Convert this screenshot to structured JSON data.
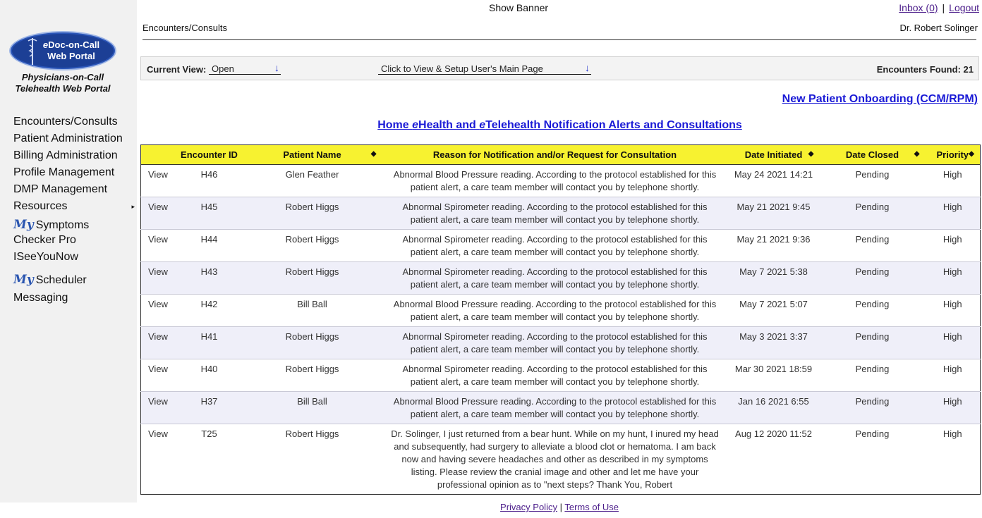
{
  "header": {
    "banner": "Show Banner",
    "inbox": "Inbox (0)",
    "separator": "|",
    "logout": "Logout",
    "breadcrumb": "Encounters/Consults",
    "user": "Dr. Robert Solinger"
  },
  "logo": {
    "prefix": "e",
    "line1_rest": "Doc-on-Call",
    "line2": "Web Portal",
    "sub1": "Physicians-on-Call",
    "sub2": "Telehealth Web Portal"
  },
  "sidebar": {
    "items": [
      {
        "label": "Encounters/Consults"
      },
      {
        "label": "Patient Administration"
      },
      {
        "label": "Billing Administration"
      },
      {
        "label": "Profile Management"
      },
      {
        "label": "DMP Management"
      },
      {
        "label": "Resources",
        "caret": "▸"
      },
      {
        "my": "My",
        "label": "Symptoms"
      },
      {
        "label": "Checker Pro"
      },
      {
        "label": "ISeeYouNow"
      },
      {
        "my": "My",
        "label": "Scheduler"
      },
      {
        "label": "Messaging"
      }
    ]
  },
  "toolbar": {
    "current_view_label": "Current View:",
    "current_view_value": "Open",
    "main_page_select": "Click to View & Setup User's Main Page",
    "arrow": "↓",
    "found_label": "Encounters Found:",
    "found_count": "21"
  },
  "onboarding_link": "New Patient Onboarding (CCM/RPM)",
  "table_title": {
    "part1": "Home ",
    "e1": "e",
    "part2": "Health and ",
    "e2": "e",
    "part3": "Telehealth Notification Alerts and Consultations"
  },
  "table": {
    "sort_icon": "◆",
    "columns": [
      {
        "label": ""
      },
      {
        "label": "Encounter ID"
      },
      {
        "label": "Patient Name"
      },
      {
        "label": "Reason for Notification and/or Request for Consultation"
      },
      {
        "label": "Date Initiated"
      },
      {
        "label": "Date Closed"
      },
      {
        "label": "Priority"
      }
    ],
    "rows": [
      {
        "view": "View",
        "id": "H46",
        "patient": "Glen Feather",
        "reason": "Abnormal Blood Pressure reading. According to the protocol established for this patient alert, a care team member will contact you by telephone shortly.",
        "initiated": "May 24 2021 14:21",
        "closed": "Pending",
        "priority": "High"
      },
      {
        "view": "View",
        "id": "H45",
        "patient": "Robert Higgs",
        "reason": "Abnormal Spirometer reading. According to the protocol established for this patient alert, a care team member will contact you by telephone shortly.",
        "initiated": "May 21 2021 9:45",
        "closed": "Pending",
        "priority": "High"
      },
      {
        "view": "View",
        "id": "H44",
        "patient": "Robert Higgs",
        "reason": "Abnormal Spirometer reading. According to the protocol established for this patient alert, a care team member will contact you by telephone shortly.",
        "initiated": "May 21 2021 9:36",
        "closed": "Pending",
        "priority": "High"
      },
      {
        "view": "View",
        "id": "H43",
        "patient": "Robert Higgs",
        "reason": "Abnormal Spirometer reading. According to the protocol established for this patient alert, a care team member will contact you by telephone shortly.",
        "initiated": "May 7 2021 5:38",
        "closed": "Pending",
        "priority": "High"
      },
      {
        "view": "View",
        "id": "H42",
        "patient": "Bill Ball",
        "reason": "Abnormal Blood Pressure reading. According to the protocol established for this patient alert, a care team member will contact you by telephone shortly.",
        "initiated": "May 7 2021 5:07",
        "closed": "Pending",
        "priority": "High"
      },
      {
        "view": "View",
        "id": "H41",
        "patient": "Robert Higgs",
        "reason": "Abnormal Spirometer reading. According to the protocol established for this patient alert, a care team member will contact you by telephone shortly.",
        "initiated": "May 3 2021 3:37",
        "closed": "Pending",
        "priority": "High"
      },
      {
        "view": "View",
        "id": "H40",
        "patient": "Robert Higgs",
        "reason": "Abnormal Spirometer reading. According to the protocol established for this patient alert, a care team member will contact you by telephone shortly.",
        "initiated": "Mar 30 2021 18:59",
        "closed": "Pending",
        "priority": "High"
      },
      {
        "view": "View",
        "id": "H37",
        "patient": "Bill Ball",
        "reason": "Abnormal Blood Pressure reading. According to the protocol established for this patient alert, a care team member will contact you by telephone shortly.",
        "initiated": "Jan 16 2021 6:55",
        "closed": "Pending",
        "priority": "High"
      },
      {
        "view": "View",
        "id": "T25",
        "patient": "Robert Higgs",
        "reason": "Dr. Solinger, I just returned from a bear hunt. While on my hunt, I inured my head and subsequently, had surgery to alleviate a blood clot or hematoma. I am back now and having severe headaches and other as described in my symptoms listing. Please review the cranial image and other and let me have your professional opinion as to \"next steps? Thank You, Robert",
        "initiated": "Aug 12 2020 11:52",
        "closed": "Pending",
        "priority": "High"
      }
    ]
  },
  "footer": {
    "privacy": "Privacy Policy",
    "separator": "|",
    "terms": "Terms of Use"
  },
  "colors": {
    "header_bg": "#f7f230",
    "link": "#1a1ad6",
    "status": "#e02020",
    "logo_bg": "#1c3f95"
  }
}
